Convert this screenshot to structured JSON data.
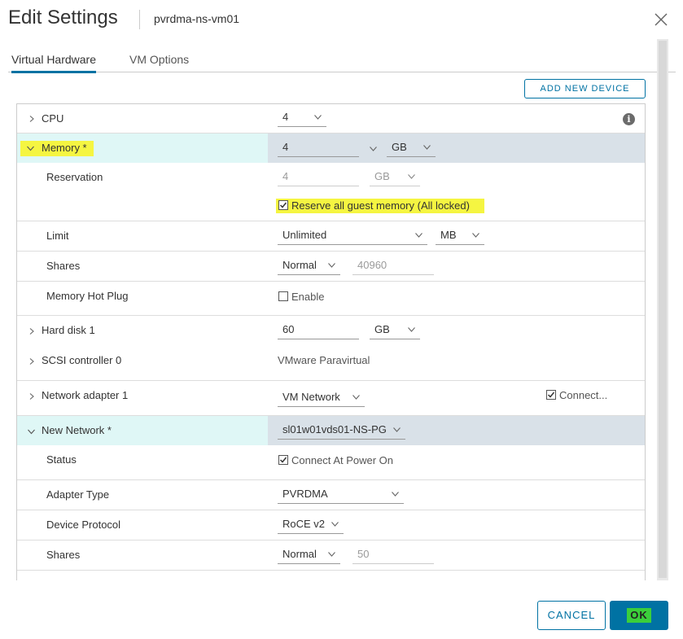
{
  "dialog": {
    "title": "Edit Settings",
    "vm_name": "pvrdma-ns-vm01",
    "close_icon": "close-icon"
  },
  "tabs": [
    {
      "label": "Virtual Hardware",
      "active": true
    },
    {
      "label": "VM Options",
      "active": false
    }
  ],
  "add_device_label": "ADD NEW DEVICE",
  "cpu": {
    "label": "CPU",
    "value": "4"
  },
  "memory": {
    "label": "Memory *",
    "value": "4",
    "unit": "GB",
    "reservation": {
      "label": "Reservation",
      "value": "4",
      "unit": "GB"
    },
    "reserve_all": {
      "label": "Reserve all guest memory (All locked)",
      "checked": true
    },
    "limit": {
      "label": "Limit",
      "value": "Unlimited",
      "unit": "MB"
    },
    "shares": {
      "label": "Shares",
      "level": "Normal",
      "value": "40960"
    },
    "hot_plug": {
      "label": "Memory Hot Plug",
      "option": "Enable",
      "checked": false
    }
  },
  "hard_disk": {
    "label": "Hard disk 1",
    "value": "60",
    "unit": "GB"
  },
  "scsi": {
    "label": "SCSI controller 0",
    "value": "VMware Paravirtual"
  },
  "network_adapter": {
    "label": "Network adapter 1",
    "value": "VM Network",
    "connect_label": "Connect...",
    "connected": true
  },
  "new_network": {
    "label": "New Network *",
    "value": "sl01w01vds01-NS-PG",
    "status": {
      "label": "Status",
      "option": "Connect At Power On",
      "checked": true
    },
    "adapter_type": {
      "label": "Adapter Type",
      "value": "PVRDMA"
    },
    "device_protocol": {
      "label": "Device Protocol",
      "value": "RoCE v2"
    },
    "shares": {
      "label": "Shares",
      "level": "Normal",
      "value": "50"
    }
  },
  "footer": {
    "cancel_label": "CANCEL",
    "ok_label": "OK"
  },
  "colors": {
    "accent": "#0072a3",
    "highlight": "#f5f541",
    "ok_highlight": "#3bcf3b",
    "row_header_left": "#dff7f6",
    "row_header_right": "#d9e1e8"
  }
}
